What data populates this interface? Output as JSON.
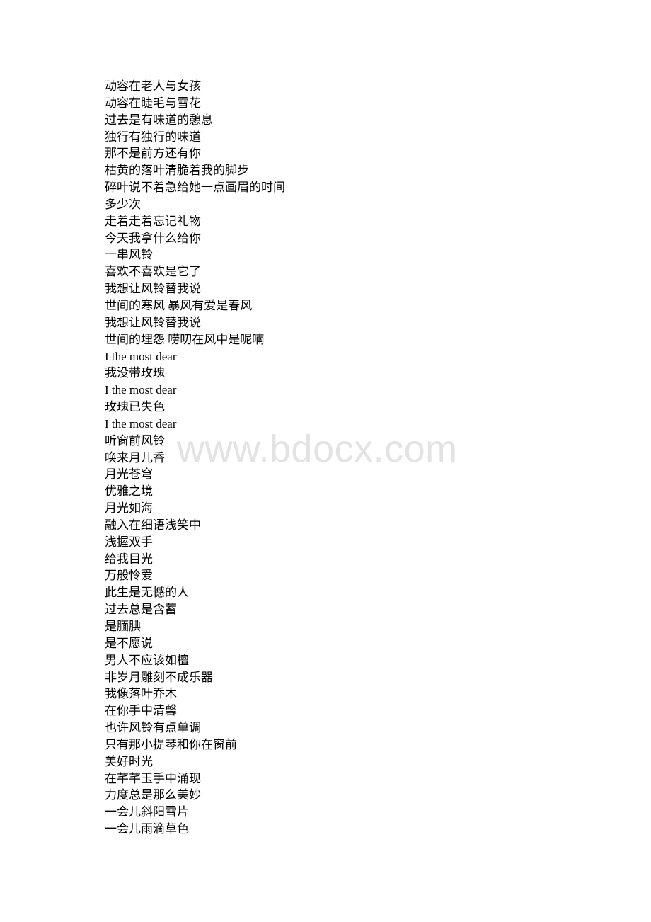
{
  "document": {
    "lines": [
      "动容在老人与女孩",
      "动容在睫毛与雪花",
      "过去是有味道的憩息",
      "独行有独行的味道",
      "那不是前方还有你",
      "枯黄的落叶清脆着我的脚步",
      "碎叶说不着急给她一点画眉的时间",
      "多少次",
      "走着走着忘记礼物",
      "今天我拿什么给你",
      "一串风铃",
      "喜欢不喜欢是它了",
      "我想让风铃替我说",
      "世间的寒风 暴风有爱是春风",
      "我想让风铃替我说",
      "世间的埋怨 唠叨在风中是呢喃",
      "I the most dear",
      "我没带玫瑰",
      "I the most dear",
      "玫瑰已失色",
      "I the most dear",
      "听窗前风铃",
      "唤来月儿香",
      "月光苍穹",
      "优雅之境",
      "月光如海",
      "融入在细语浅笑中",
      "浅握双手",
      "给我目光",
      "万般怜爱",
      "此生是无憾的人",
      "过去总是含蓄",
      "是腼腆",
      "是不愿说",
      "男人不应该如檀",
      "非岁月雕刻不成乐器",
      "我像落叶乔木",
      "在你手中清馨",
      "也许风铃有点单调",
      "只有那小提琴和你在窗前",
      "美好时光",
      "在芊芊玉手中涌现",
      "力度总是那么美妙",
      "一会儿斜阳雪片",
      "一会儿雨滴草色"
    ]
  },
  "watermark": {
    "text": "www.bdocx.com",
    "color": "#e3e3e3"
  }
}
